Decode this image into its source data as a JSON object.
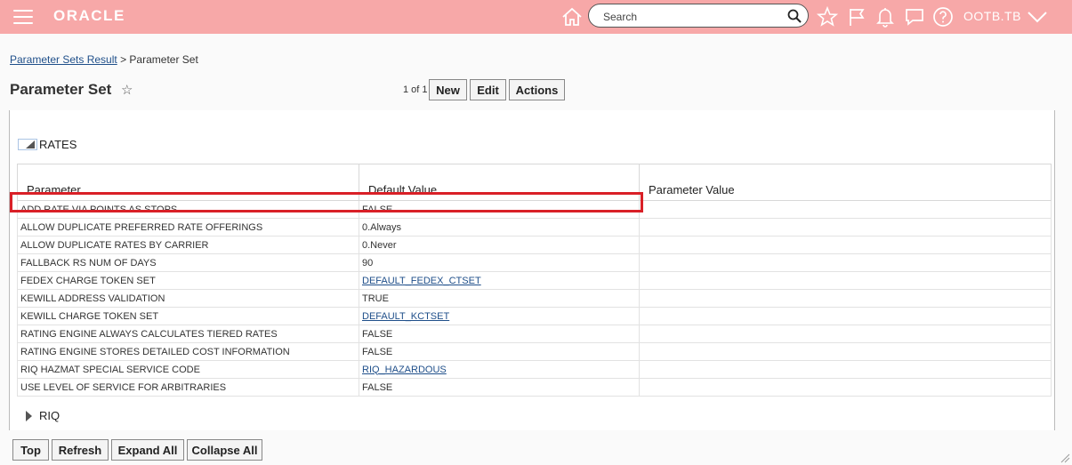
{
  "header": {
    "logo": "ORACLE",
    "search_placeholder": "Search",
    "user": "OOTB.TB",
    "icons": [
      "menu-icon",
      "home-icon",
      "search-icon",
      "star-icon",
      "flag-icon",
      "bell-icon",
      "chat-icon",
      "help-icon",
      "chevron-down-icon"
    ]
  },
  "breadcrumb": {
    "link": "Parameter Sets Result",
    "separator": ">",
    "current": "Parameter Set"
  },
  "page": {
    "title": "Parameter Set",
    "pager": "1 of 1"
  },
  "toolbar": {
    "new": "New",
    "edit": "Edit",
    "actions": "Actions"
  },
  "sections": {
    "rates": {
      "label": "RATES"
    },
    "riq": {
      "label": "RIQ"
    }
  },
  "table": {
    "columns": [
      "Parameter",
      "Default Value",
      "Parameter Value"
    ],
    "rows": [
      {
        "parameter": "ADD RATE VIA POINTS AS STOPS",
        "default": "FALSE",
        "value": "",
        "link": false
      },
      {
        "parameter": "ALLOW DUPLICATE PREFERRED RATE OFFERINGS",
        "default": "0.Always",
        "value": "",
        "link": false
      },
      {
        "parameter": "ALLOW DUPLICATE RATES BY CARRIER",
        "default": "0.Never",
        "value": "",
        "link": false
      },
      {
        "parameter": "FALLBACK RS NUM OF DAYS",
        "default": "90",
        "value": "",
        "link": false
      },
      {
        "parameter": "FEDEX CHARGE TOKEN SET",
        "default": "DEFAULT_FEDEX_CTSET",
        "value": "",
        "link": true
      },
      {
        "parameter": "KEWILL ADDRESS VALIDATION",
        "default": "TRUE",
        "value": "",
        "link": false
      },
      {
        "parameter": "KEWILL CHARGE TOKEN SET",
        "default": "DEFAULT_KCTSET",
        "value": "",
        "link": true
      },
      {
        "parameter": "RATING ENGINE ALWAYS CALCULATES TIERED RATES",
        "default": "FALSE",
        "value": "",
        "link": false
      },
      {
        "parameter": "RATING ENGINE STORES DETAILED COST INFORMATION",
        "default": "FALSE",
        "value": "",
        "link": false
      },
      {
        "parameter": "RIQ HAZMAT SPECIAL SERVICE CODE",
        "default": "RIQ_HAZARDOUS",
        "value": "",
        "link": true
      },
      {
        "parameter": "USE LEVEL OF SERVICE FOR ARBITRARIES",
        "default": "FALSE",
        "value": "",
        "link": false
      }
    ]
  },
  "footer": {
    "top": "Top",
    "refresh": "Refresh",
    "expand_all": "Expand All",
    "collapse_all": "Collapse All"
  },
  "colors": {
    "header_bg": "#f7a8a8",
    "highlight": "#d92027",
    "link": "#1f4f8a"
  }
}
